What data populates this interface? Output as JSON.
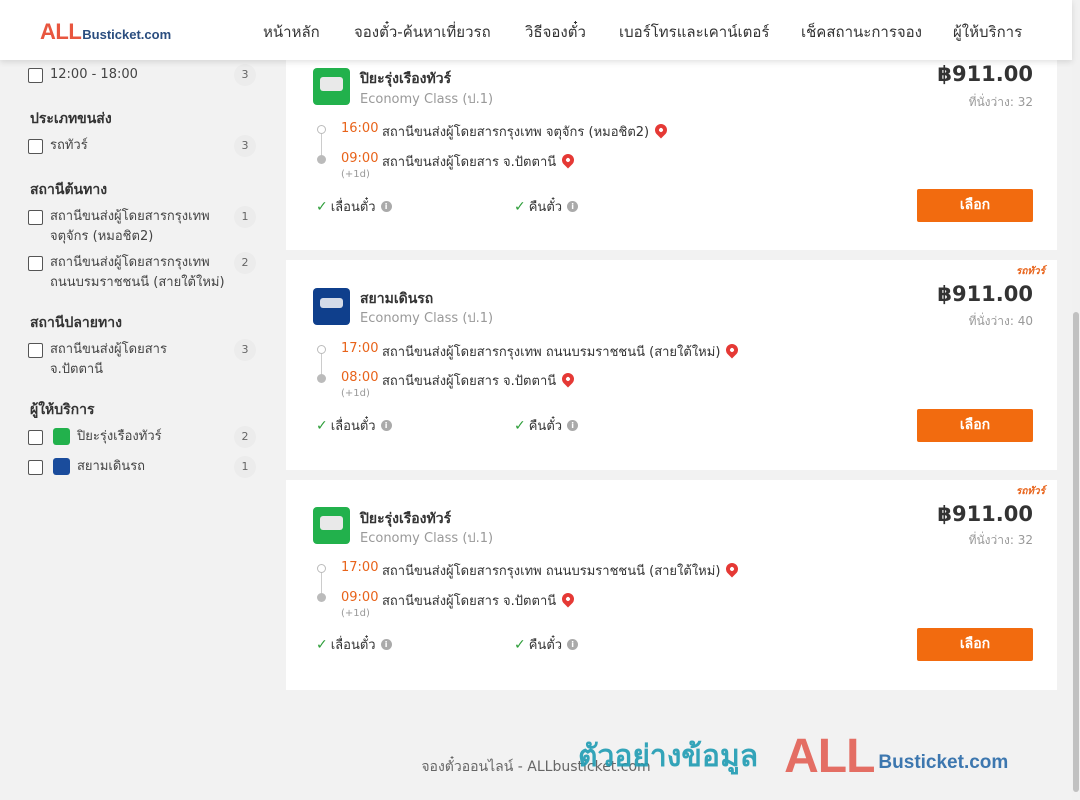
{
  "header": {
    "logo_all": "ALL",
    "logo_bus": "Busticket.com",
    "nav": [
      "หน้าหลัก",
      "จองตั๋ว-ค้นหาเที่ยวรถ",
      "วิธีจองตั๋ว",
      "เบอร์โทรและเคาน์เตอร์",
      "เช็คสถานะการจอง",
      "ผู้ให้บริการ"
    ]
  },
  "filters": {
    "time_item": {
      "label": "12:00 - 18:00",
      "count": "3"
    },
    "transport": {
      "title": "ประเภทขนส่ง",
      "items": [
        {
          "label": "รถทัวร์",
          "count": "3"
        }
      ]
    },
    "origin": {
      "title": "สถานีต้นทาง",
      "items": [
        {
          "label": "สถานีขนส่งผู้โดยสารกรุงเทพ จตุจักร (หมอชิต2)",
          "count": "1"
        },
        {
          "label": "สถานีขนส่งผู้โดยสารกรุงเทพ ถนนบรมราชชนนี (สายใต้ใหม่)",
          "count": "2"
        }
      ]
    },
    "destination": {
      "title": "สถานีปลายทาง",
      "items": [
        {
          "label": "สถานีขนส่งผู้โดยสาร จ.ปัตตานี",
          "count": "3"
        }
      ]
    },
    "operator": {
      "title": "ผู้ให้บริการ",
      "items": [
        {
          "label": "ปิยะรุ่งเรืองทัวร์",
          "count": "2"
        },
        {
          "label": "สยามเดินรถ",
          "count": "1"
        }
      ]
    }
  },
  "trips": [
    {
      "tag": "",
      "operator": "ปิยะรุ่งเรืองทัวร์",
      "class": "Economy Class (ป.1)",
      "price": "฿911.00",
      "seats": "ที่นั่งว่าง: 32",
      "depart_time": "16:00",
      "depart_station": "สถานีขนส่งผู้โดยสารกรุงเทพ จตุจักร (หมอชิต2)",
      "arrive_time": "09:00",
      "arrive_station": "สถานีขนส่งผู้โดยสาร จ.ปัตตานี",
      "day_offset": "(+1d)",
      "feature1": "เลื่อนตั๋ว",
      "feature2": "คืนตั๋ว",
      "button": "เลือก"
    },
    {
      "tag": "รถทัวร์",
      "operator": "สยามเดินรถ",
      "class": "Economy Class (ป.1)",
      "price": "฿911.00",
      "seats": "ที่นั่งว่าง: 40",
      "depart_time": "17:00",
      "depart_station": "สถานีขนส่งผู้โดยสารกรุงเทพ ถนนบรมราชชนนี (สายใต้ใหม่)",
      "arrive_time": "08:00",
      "arrive_station": "สถานีขนส่งผู้โดยสาร จ.ปัตตานี",
      "day_offset": "(+1d)",
      "feature1": "เลื่อนตั๋ว",
      "feature2": "คืนตั๋ว",
      "button": "เลือก"
    },
    {
      "tag": "รถทัวร์",
      "operator": "ปิยะรุ่งเรืองทัวร์",
      "class": "Economy Class (ป.1)",
      "price": "฿911.00",
      "seats": "ที่นั่งว่าง: 32",
      "depart_time": "17:00",
      "depart_station": "สถานีขนส่งผู้โดยสารกรุงเทพ ถนนบรมราชชนนี (สายใต้ใหม่)",
      "arrive_time": "09:00",
      "arrive_station": "สถานีขนส่งผู้โดยสาร จ.ปัตตานี",
      "day_offset": "(+1d)",
      "feature1": "เลื่อนตั๋ว",
      "feature2": "คืนตั๋ว",
      "button": "เลือก"
    }
  ],
  "footer": {
    "text": "จองตั๋วออนไลน์ - ALLbusticket.com"
  },
  "watermark": {
    "thai": "ตัวอย่างข้อมูล",
    "all": "ALL",
    "bus": "Busticket.com"
  },
  "colors": {
    "accent": "#f26b0f",
    "brand_red": "#e8563f",
    "brand_blue": "#2a4d7f",
    "check": "#2e9e3a"
  }
}
